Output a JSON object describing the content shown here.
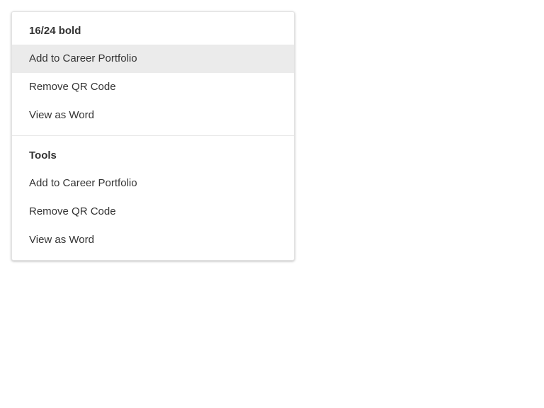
{
  "menu": {
    "groups": [
      {
        "header": "16/24 bold",
        "items": [
          {
            "label": "Add to Career Portfolio",
            "highlighted": true
          },
          {
            "label": "Remove QR Code"
          },
          {
            "label": "View as Word"
          }
        ]
      },
      {
        "header": "Tools",
        "items": [
          {
            "label": "Add to Career Portfolio"
          },
          {
            "label": "Remove QR Code"
          },
          {
            "label": "View as Word"
          }
        ]
      }
    ]
  },
  "colors": {
    "highlight": "#ebebeb",
    "text": "#333333",
    "separator": "#e8e8e8"
  }
}
